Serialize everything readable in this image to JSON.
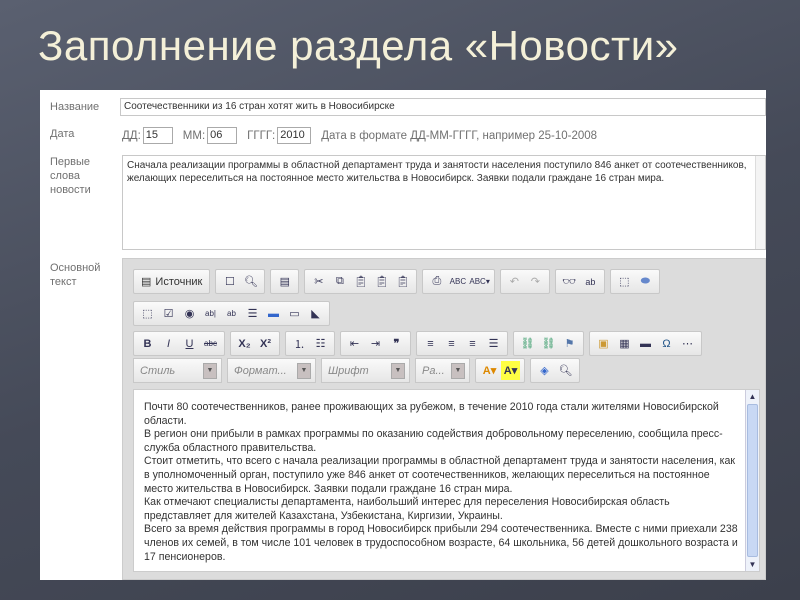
{
  "slide_title": "Заполнение раздела «Новости»",
  "form": {
    "name_label": "Название",
    "name_value": "Соотечественники из 16 стран хотят жить в Новосибирске",
    "date_label": "Дата",
    "day_label": "ДД:",
    "day_value": "15",
    "month_label": "ММ:",
    "month_value": "06",
    "year_label": "ГГГГ:",
    "year_value": "2010",
    "date_hint": "Дата в формате ДД-ММ-ГГГГ, например 25-10-2008",
    "lead_label_1": "Первые",
    "lead_label_2": "слова",
    "lead_label_3": "новости",
    "lead_value": "Сначала реализации программы в областной департамент труда и занятости населения поступило 846 анкет от соотечественников, желающих переселиться на постоянное место жительства в Новосибирск. Заявки подали граждане 16 стран мира.",
    "body_label_1": "Основной",
    "body_label_2": "текст"
  },
  "toolbar": {
    "source_label": "Источник",
    "style_placeholder": "Стиль",
    "format_placeholder": "Формат...",
    "font_placeholder": "Шрифт",
    "size_placeholder": "Ра..."
  },
  "body_paragraphs": [
    "Почти 80 соотечественников, ранее проживающих за рубежом, в течение 2010 года стали жителями Новосибирской области.",
    "В регион они прибыли в рамках программы по оказанию содействия добровольному переселению, сообщила пресс-служба областного правительства.",
    "Стоит отметить, что всего с начала реализации программы в областной департамент труда и занятости населения, как в уполномоченный орган, поступило уже 846 анкет от соотечественников, желающих переселиться на постоянное место жительства в Новосибирск. Заявки подали граждане 16 стран мира.",
    "Как отмечают специалисты департамента, наибольший интерес для переселения Новосибирская область представляет для жителей Казахстана, Узбекистана, Киргизии, Украины.",
    "Всего за время действия программы в город Новосибирск прибыли 294 соотечественника. Вместе с ними приехали 238 членов их семей, в том числе 101 человек в трудоспособном возрасте, 64 школьника, 56 детей дошкольного возраста и 17 пенсионеров."
  ]
}
